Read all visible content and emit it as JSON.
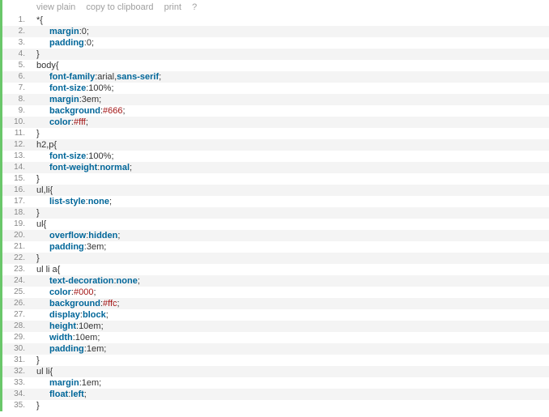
{
  "toolbar": {
    "view_plain": "view plain",
    "copy": "copy to clipboard",
    "print": "print",
    "help": "?"
  },
  "lines": [
    {
      "n": 1,
      "indent": 1,
      "tokens": [
        {
          "t": "*{",
          "c": "plain"
        }
      ]
    },
    {
      "n": 2,
      "indent": 2,
      "tokens": [
        {
          "t": "margin",
          "c": "kw"
        },
        {
          "t": ":",
          "c": "plain"
        },
        {
          "t": "0",
          "c": "plain"
        },
        {
          "t": ";",
          "c": "plain"
        }
      ]
    },
    {
      "n": 3,
      "indent": 2,
      "tokens": [
        {
          "t": "padding",
          "c": "kw"
        },
        {
          "t": ":",
          "c": "plain"
        },
        {
          "t": "0",
          "c": "plain"
        },
        {
          "t": ";",
          "c": "plain"
        }
      ]
    },
    {
      "n": 4,
      "indent": 1,
      "tokens": [
        {
          "t": "}",
          "c": "plain"
        }
      ]
    },
    {
      "n": 5,
      "indent": 1,
      "tokens": [
        {
          "t": "body{",
          "c": "plain"
        }
      ]
    },
    {
      "n": 6,
      "indent": 2,
      "tokens": [
        {
          "t": "font-family",
          "c": "kw"
        },
        {
          "t": ":arial,",
          "c": "plain"
        },
        {
          "t": "sans-serif",
          "c": "val"
        },
        {
          "t": ";",
          "c": "plain"
        }
      ]
    },
    {
      "n": 7,
      "indent": 2,
      "tokens": [
        {
          "t": "font-size",
          "c": "kw"
        },
        {
          "t": ":",
          "c": "plain"
        },
        {
          "t": "100%",
          "c": "plain"
        },
        {
          "t": ";",
          "c": "plain"
        }
      ]
    },
    {
      "n": 8,
      "indent": 2,
      "tokens": [
        {
          "t": "margin",
          "c": "kw"
        },
        {
          "t": ":",
          "c": "plain"
        },
        {
          "t": "3em",
          "c": "plain"
        },
        {
          "t": ";",
          "c": "plain"
        }
      ]
    },
    {
      "n": 9,
      "indent": 2,
      "tokens": [
        {
          "t": "background",
          "c": "kw"
        },
        {
          "t": ":",
          "c": "plain"
        },
        {
          "t": "#666",
          "c": "hex"
        },
        {
          "t": ";",
          "c": "plain"
        }
      ]
    },
    {
      "n": 10,
      "indent": 2,
      "tokens": [
        {
          "t": "color",
          "c": "kw"
        },
        {
          "t": ":",
          "c": "plain"
        },
        {
          "t": "#fff",
          "c": "hex"
        },
        {
          "t": ";",
          "c": "plain"
        }
      ]
    },
    {
      "n": 11,
      "indent": 1,
      "tokens": [
        {
          "t": "}",
          "c": "plain"
        }
      ]
    },
    {
      "n": 12,
      "indent": 1,
      "tokens": [
        {
          "t": "h2,p{",
          "c": "plain"
        }
      ]
    },
    {
      "n": 13,
      "indent": 2,
      "tokens": [
        {
          "t": "font-size",
          "c": "kw"
        },
        {
          "t": ":",
          "c": "plain"
        },
        {
          "t": "100%",
          "c": "plain"
        },
        {
          "t": ";",
          "c": "plain"
        }
      ]
    },
    {
      "n": 14,
      "indent": 2,
      "tokens": [
        {
          "t": "font-weight",
          "c": "kw"
        },
        {
          "t": ":",
          "c": "plain"
        },
        {
          "t": "normal",
          "c": "val"
        },
        {
          "t": ";",
          "c": "plain"
        }
      ]
    },
    {
      "n": 15,
      "indent": 1,
      "tokens": [
        {
          "t": "}",
          "c": "plain"
        }
      ]
    },
    {
      "n": 16,
      "indent": 1,
      "tokens": [
        {
          "t": "ul,li{",
          "c": "plain"
        }
      ]
    },
    {
      "n": 17,
      "indent": 2,
      "tokens": [
        {
          "t": "list-style",
          "c": "kw"
        },
        {
          "t": ":",
          "c": "plain"
        },
        {
          "t": "none",
          "c": "val"
        },
        {
          "t": ";",
          "c": "plain"
        }
      ]
    },
    {
      "n": 18,
      "indent": 1,
      "tokens": [
        {
          "t": "}",
          "c": "plain"
        }
      ]
    },
    {
      "n": 19,
      "indent": 1,
      "tokens": [
        {
          "t": "ul{",
          "c": "plain"
        }
      ]
    },
    {
      "n": 20,
      "indent": 2,
      "tokens": [
        {
          "t": "overflow",
          "c": "kw"
        },
        {
          "t": ":",
          "c": "plain"
        },
        {
          "t": "hidden",
          "c": "val"
        },
        {
          "t": ";",
          "c": "plain"
        }
      ]
    },
    {
      "n": 21,
      "indent": 2,
      "tokens": [
        {
          "t": "padding",
          "c": "kw"
        },
        {
          "t": ":",
          "c": "plain"
        },
        {
          "t": "3em",
          "c": "plain"
        },
        {
          "t": ";",
          "c": "plain"
        }
      ]
    },
    {
      "n": 22,
      "indent": 1,
      "tokens": [
        {
          "t": "}",
          "c": "plain"
        }
      ]
    },
    {
      "n": 23,
      "indent": 1,
      "tokens": [
        {
          "t": "ul li a{",
          "c": "plain"
        }
      ]
    },
    {
      "n": 24,
      "indent": 2,
      "tokens": [
        {
          "t": "text-decoration",
          "c": "kw"
        },
        {
          "t": ":",
          "c": "plain"
        },
        {
          "t": "none",
          "c": "val"
        },
        {
          "t": ";",
          "c": "plain"
        }
      ]
    },
    {
      "n": 25,
      "indent": 2,
      "tokens": [
        {
          "t": "color",
          "c": "kw"
        },
        {
          "t": ":",
          "c": "plain"
        },
        {
          "t": "#000",
          "c": "hex"
        },
        {
          "t": ";",
          "c": "plain"
        }
      ]
    },
    {
      "n": 26,
      "indent": 2,
      "tokens": [
        {
          "t": "background",
          "c": "kw"
        },
        {
          "t": ":",
          "c": "plain"
        },
        {
          "t": "#ffc",
          "c": "hex"
        },
        {
          "t": ";",
          "c": "plain"
        }
      ]
    },
    {
      "n": 27,
      "indent": 2,
      "tokens": [
        {
          "t": "display",
          "c": "kw"
        },
        {
          "t": ":",
          "c": "plain"
        },
        {
          "t": "block",
          "c": "val"
        },
        {
          "t": ";",
          "c": "plain"
        }
      ]
    },
    {
      "n": 28,
      "indent": 2,
      "tokens": [
        {
          "t": "height",
          "c": "kw"
        },
        {
          "t": ":",
          "c": "plain"
        },
        {
          "t": "10em",
          "c": "plain"
        },
        {
          "t": ";",
          "c": "plain"
        }
      ]
    },
    {
      "n": 29,
      "indent": 2,
      "tokens": [
        {
          "t": "width",
          "c": "kw"
        },
        {
          "t": ":",
          "c": "plain"
        },
        {
          "t": "10em",
          "c": "plain"
        },
        {
          "t": ";",
          "c": "plain"
        }
      ]
    },
    {
      "n": 30,
      "indent": 2,
      "tokens": [
        {
          "t": "padding",
          "c": "kw"
        },
        {
          "t": ":",
          "c": "plain"
        },
        {
          "t": "1em",
          "c": "plain"
        },
        {
          "t": ";",
          "c": "plain"
        }
      ]
    },
    {
      "n": 31,
      "indent": 1,
      "tokens": [
        {
          "t": "}",
          "c": "plain"
        }
      ]
    },
    {
      "n": 32,
      "indent": 1,
      "tokens": [
        {
          "t": "ul li{",
          "c": "plain"
        }
      ]
    },
    {
      "n": 33,
      "indent": 2,
      "tokens": [
        {
          "t": "margin",
          "c": "kw"
        },
        {
          "t": ":",
          "c": "plain"
        },
        {
          "t": "1em",
          "c": "plain"
        },
        {
          "t": ";",
          "c": "plain"
        }
      ]
    },
    {
      "n": 34,
      "indent": 2,
      "tokens": [
        {
          "t": "float",
          "c": "kw"
        },
        {
          "t": ":",
          "c": "plain"
        },
        {
          "t": "left",
          "c": "val"
        },
        {
          "t": ";",
          "c": "plain"
        }
      ]
    },
    {
      "n": 35,
      "indent": 1,
      "tokens": [
        {
          "t": "}",
          "c": "plain"
        }
      ]
    }
  ]
}
